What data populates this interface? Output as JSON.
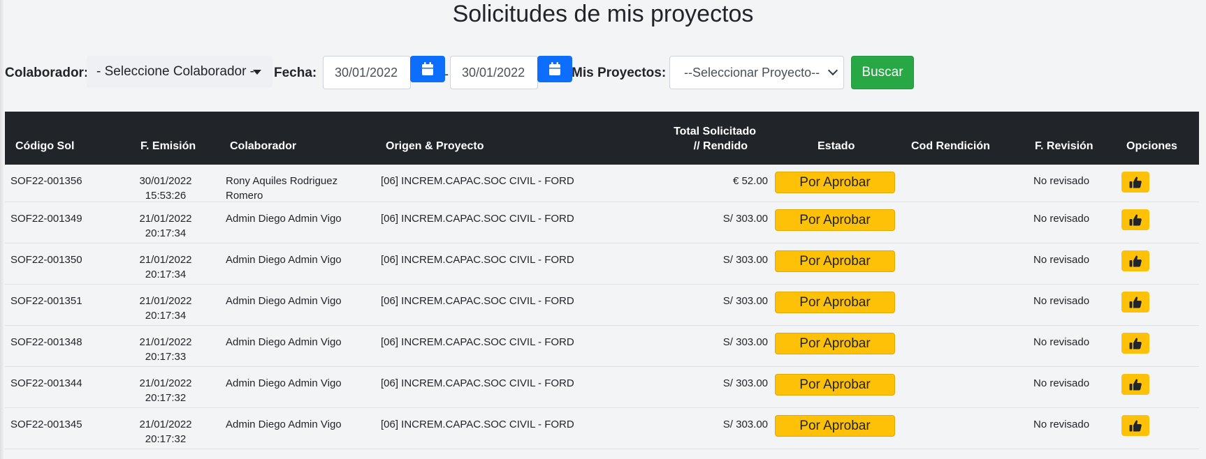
{
  "page": {
    "title": "Solicitudes de mis proyectos"
  },
  "filters": {
    "colaborador_label": "Colaborador:",
    "colaborador_value": "- Seleccione Colaborador -",
    "fecha_label": "Fecha:",
    "fecha_desde": "30/01/2022",
    "fecha_hasta": "30/01/2022",
    "separator": "-",
    "proyectos_label": "Mis Proyectos:",
    "proyectos_value": "--Seleccionar Proyecto--",
    "buscar_label": "Buscar"
  },
  "table": {
    "headers": {
      "codigo": "Código Sol",
      "emision": "F. Emisión",
      "colaborador": "Colaborador",
      "origen": "Origen & Proyecto",
      "total_line1": "Total Solicitado",
      "total_line2": "// Rendido",
      "estado": "Estado",
      "cod_rendicion": "Cod Rendición",
      "revision": "F. Revisión",
      "opciones": "Opciones"
    },
    "rows": [
      {
        "codigo": "SOF22-001356",
        "fecha": "30/01/2022",
        "hora": "15:53:26",
        "colaborador_l1": "Rony Aquiles Rodriguez",
        "colaborador_l2": "Romero",
        "origen": "[06] INCREM.CAPAC.SOC CIVIL - FORD",
        "total": "€ 52.00",
        "estado": "Por Aprobar",
        "cod_rendicion": "",
        "revision": "No revisado"
      },
      {
        "codigo": "SOF22-001349",
        "fecha": "21/01/2022",
        "hora": "20:17:34",
        "colaborador_l1": "Admin Diego Admin Vigo",
        "colaborador_l2": "",
        "origen": "[06] INCREM.CAPAC.SOC CIVIL - FORD",
        "total": "S/ 303.00",
        "estado": "Por Aprobar",
        "cod_rendicion": "",
        "revision": "No revisado"
      },
      {
        "codigo": "SOF22-001350",
        "fecha": "21/01/2022",
        "hora": "20:17:34",
        "colaborador_l1": "Admin Diego Admin Vigo",
        "colaborador_l2": "",
        "origen": "[06] INCREM.CAPAC.SOC CIVIL - FORD",
        "total": "S/ 303.00",
        "estado": "Por Aprobar",
        "cod_rendicion": "",
        "revision": "No revisado"
      },
      {
        "codigo": "SOF22-001351",
        "fecha": "21/01/2022",
        "hora": "20:17:34",
        "colaborador_l1": "Admin Diego Admin Vigo",
        "colaborador_l2": "",
        "origen": "[06] INCREM.CAPAC.SOC CIVIL - FORD",
        "total": "S/ 303.00",
        "estado": "Por Aprobar",
        "cod_rendicion": "",
        "revision": "No revisado"
      },
      {
        "codigo": "SOF22-001348",
        "fecha": "21/01/2022",
        "hora": "20:17:33",
        "colaborador_l1": "Admin Diego Admin Vigo",
        "colaborador_l2": "",
        "origen": "[06] INCREM.CAPAC.SOC CIVIL - FORD",
        "total": "S/ 303.00",
        "estado": "Por Aprobar",
        "cod_rendicion": "",
        "revision": "No revisado"
      },
      {
        "codigo": "SOF22-001344",
        "fecha": "21/01/2022",
        "hora": "20:17:32",
        "colaborador_l1": "Admin Diego Admin Vigo",
        "colaborador_l2": "",
        "origen": "[06] INCREM.CAPAC.SOC CIVIL - FORD",
        "total": "S/ 303.00",
        "estado": "Por Aprobar",
        "cod_rendicion": "",
        "revision": "No revisado"
      },
      {
        "codigo": "SOF22-001345",
        "fecha": "21/01/2022",
        "hora": "20:17:32",
        "colaborador_l1": "Admin Diego Admin Vigo",
        "colaborador_l2": "",
        "origen": "[06] INCREM.CAPAC.SOC CIVIL - FORD",
        "total": "S/ 303.00",
        "estado": "Por Aprobar",
        "cod_rendicion": "",
        "revision": "No revisado"
      }
    ]
  },
  "icons": {
    "calendar": "calendar-icon",
    "approve": "thumbs-up-icon"
  },
  "colors": {
    "primary": "#0d6efd",
    "success": "#28a745",
    "warning": "#ffc107",
    "header": "#212529"
  }
}
